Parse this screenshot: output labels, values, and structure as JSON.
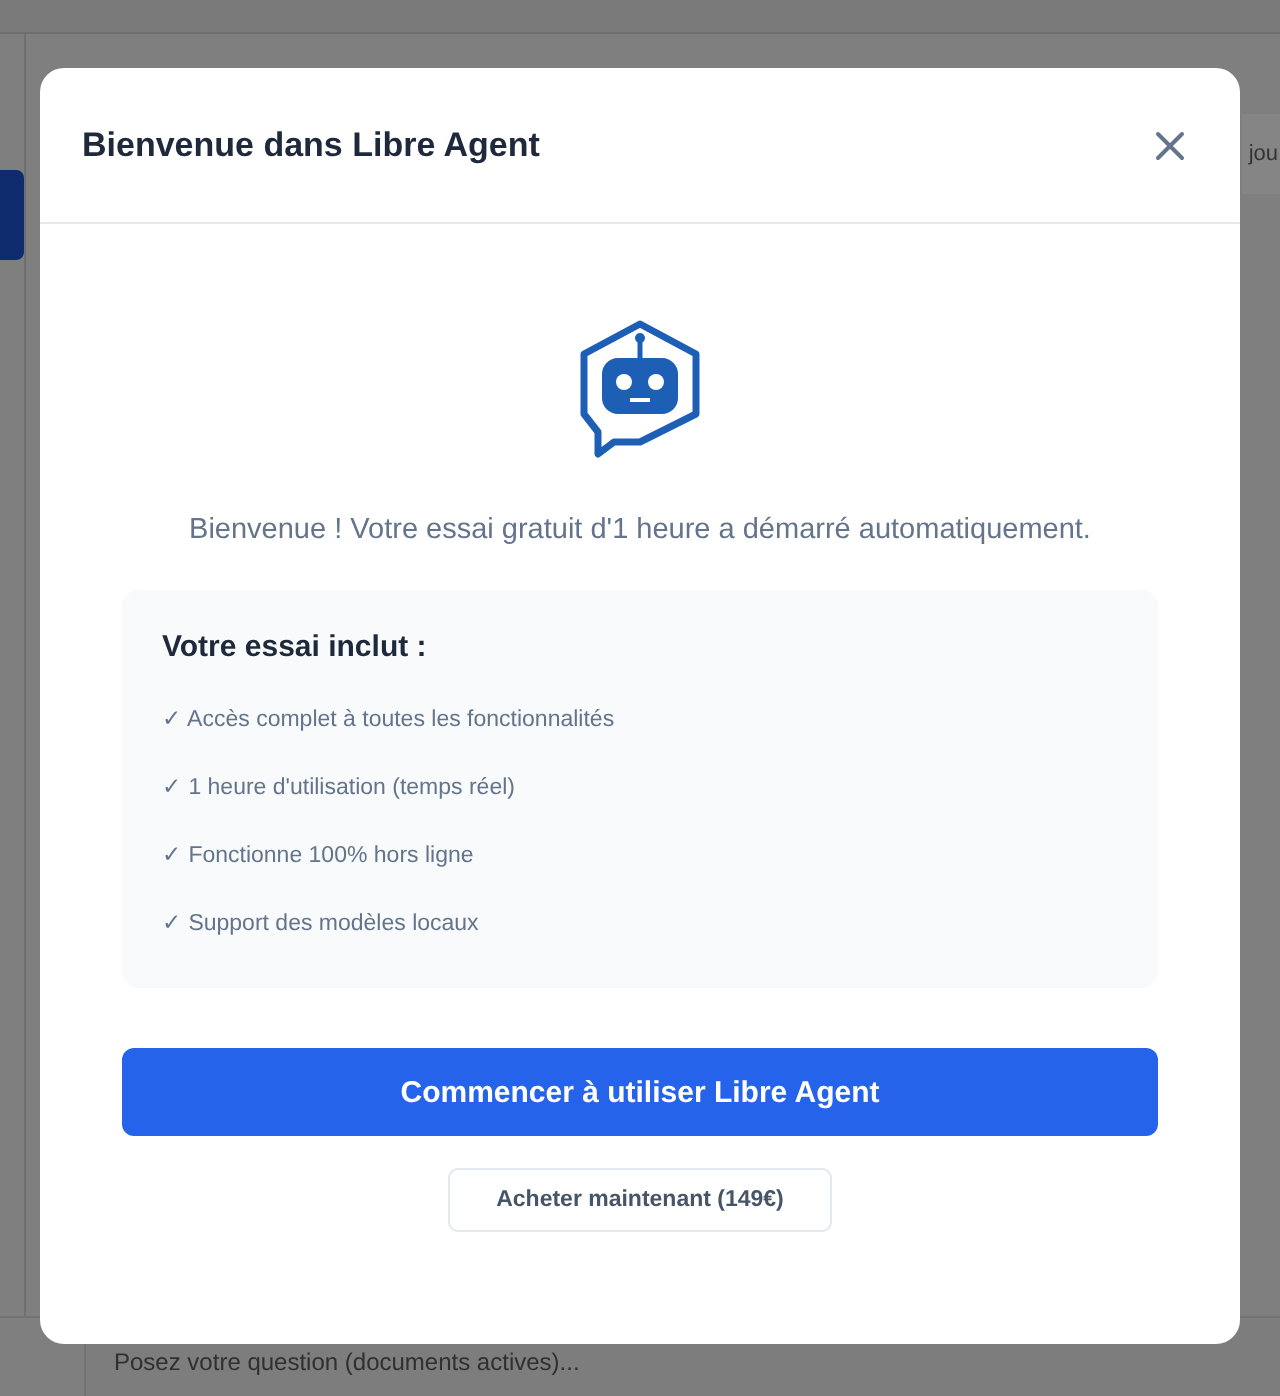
{
  "background": {
    "side_text": "jou",
    "input_placeholder": "Posez votre question (documents actives)..."
  },
  "dialog": {
    "title": "Bienvenue dans Libre Agent",
    "welcome": "Bienvenue ! Votre essai gratuit d'1 heure a démarré automatiquement.",
    "features": {
      "title": "Votre essai inclut :",
      "items": [
        "✓ Accès complet à toutes les fonctionnalités",
        "✓ 1 heure d'utilisation (temps réel)",
        "✓ Fonctionne 100% hors ligne",
        "✓ Support des modèles locaux"
      ]
    },
    "buttons": [
      {
        "label": "Commencer à utiliser Libre Agent",
        "kind": "primary"
      },
      {
        "label": "Acheter maintenant (149€)",
        "kind": "secondary"
      }
    ]
  }
}
